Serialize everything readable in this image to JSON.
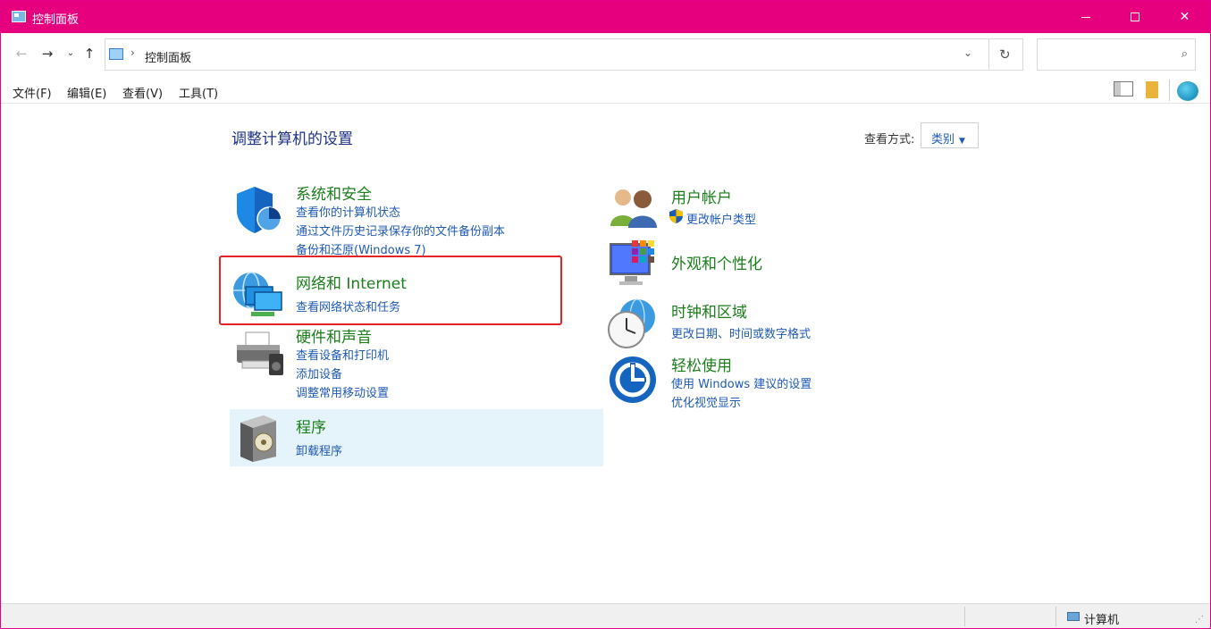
{
  "window": {
    "title": "控制面板",
    "minimize_glyph": "—",
    "close_glyph": "✕",
    "accent_color": "#e6007e"
  },
  "address": {
    "separator": "›",
    "path": "控制面板",
    "back_glyph": "←",
    "forward_glyph": "→",
    "recent_glyph": "⌄",
    "up_glyph": "↑",
    "dropdown_glyph": "⌄",
    "refresh_glyph": "↻",
    "search_placeholder": "",
    "search_glyph": "⌕"
  },
  "menu": {
    "items": [
      "文件(F)",
      "编辑(E)",
      "查看(V)",
      "工具(T)"
    ]
  },
  "content": {
    "title": "调整计算机的设置",
    "view_by_label": "查看方式:",
    "view_by_value": "类别",
    "caret": "▼"
  },
  "categories": {
    "system_security": {
      "title": "系统和安全",
      "links": [
        "查看你的计算机状态",
        "通过文件历史记录保存你的文件备份副本",
        "备份和还原(Windows 7)"
      ]
    },
    "network": {
      "title": "网络和 Internet",
      "links": [
        "查看网络状态和任务"
      ]
    },
    "hardware": {
      "title": "硬件和声音",
      "links": [
        "查看设备和打印机",
        "添加设备",
        "调整常用移动设置"
      ]
    },
    "programs": {
      "title": "程序",
      "links": [
        "卸载程序"
      ]
    },
    "user_accounts": {
      "title": "用户帐户",
      "links": [
        "更改帐户类型"
      ]
    },
    "appearance": {
      "title": "外观和个性化",
      "links": []
    },
    "clock_region": {
      "title": "时钟和区域",
      "links": [
        "更改日期、时间或数字格式"
      ]
    },
    "ease_of_access": {
      "title": "轻松使用",
      "links": [
        "使用 Windows 建议的设置",
        "优化视觉显示"
      ]
    }
  },
  "status": {
    "computer_label": "计算机",
    "grip": "⋰"
  }
}
